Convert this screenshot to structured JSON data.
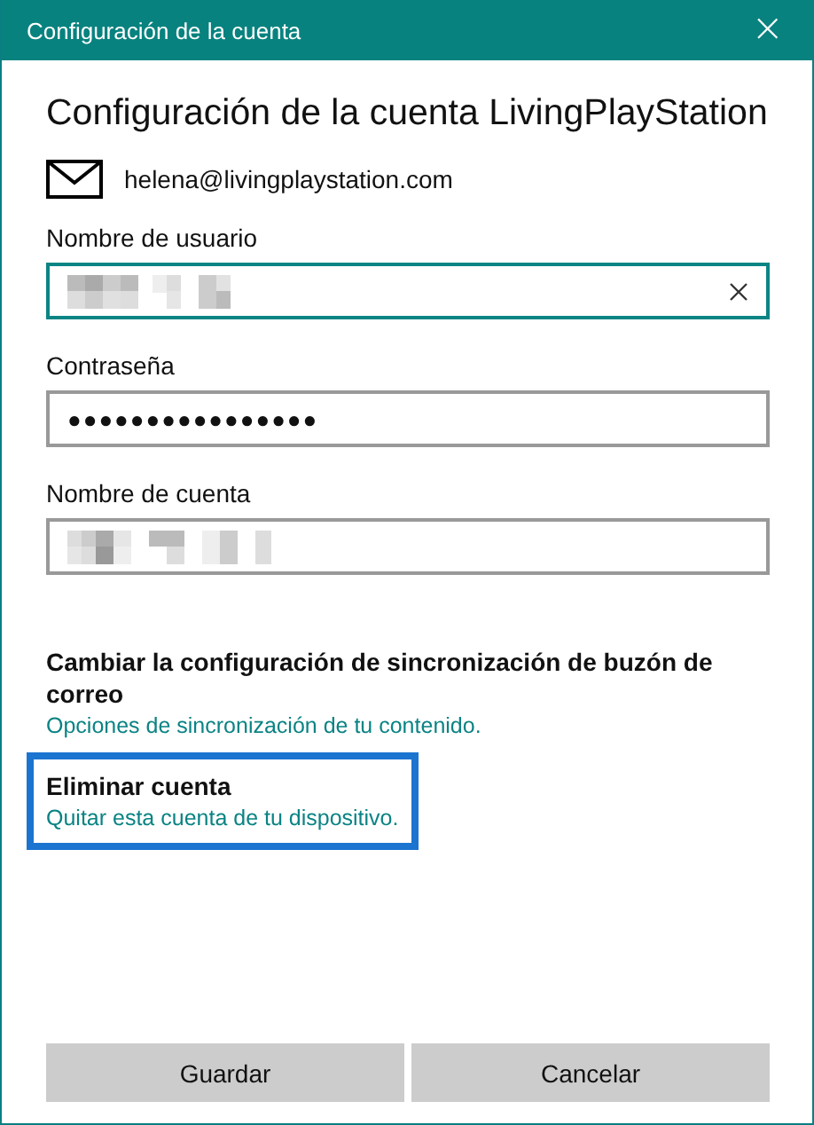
{
  "window": {
    "title": "Configuración de la cuenta",
    "close": "×"
  },
  "heading": "Configuración de la cuenta LivingPlayStation",
  "email": "helena@livingplaystation.com",
  "fields": [
    {
      "label": "Nombre de usuario",
      "kind": "redacted",
      "focused": true
    },
    {
      "label": "Contraseña",
      "kind": "password",
      "value": "●●●●●●●●●●●●●●●●",
      "focused": false
    },
    {
      "label": "Nombre de cuenta",
      "kind": "redacted",
      "focused": false
    }
  ],
  "sections": [
    {
      "title": "Cambiar la configuración de sincronización de buzón de correo",
      "link": "Opciones de sincronización de tu contenido.",
      "highlighted": false
    },
    {
      "title": "Eliminar cuenta",
      "link": "Quitar esta cuenta de tu dispositivo.",
      "highlighted": true
    }
  ],
  "buttons": [
    "Guardar",
    "Cancelar"
  ]
}
